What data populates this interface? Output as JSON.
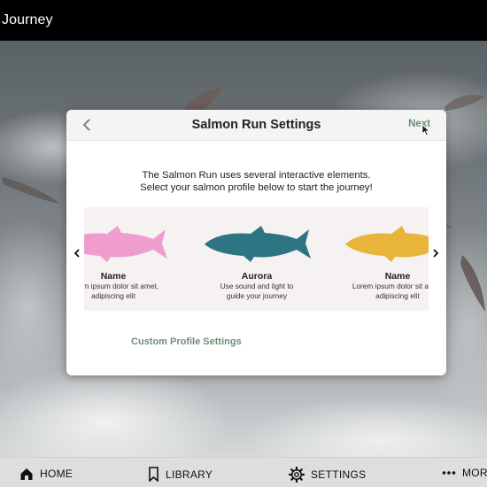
{
  "topbar": {
    "title": "Journey"
  },
  "modal": {
    "title": "Salmon Run Settings",
    "next_label": "Next",
    "intro_line1": "The Salmon Run uses several interactive elements.",
    "intro_line2": "Select your salmon profile below to start the journey!",
    "profiles": [
      {
        "name": "Name",
        "description": "Lorem ipsum dolor sit amet,\nadipiscing elit",
        "color": "#ef9ccf"
      },
      {
        "name": "Aurora",
        "description": "Use sound and light to\nguide your journey",
        "color": "#2e7584"
      },
      {
        "name": "Name",
        "description": "Lorem ipsum dolor sit amet,\nadipiscing elit",
        "color": "#e8b43c"
      }
    ],
    "custom_link": "Custom Profile Settings",
    "accent_color": "#6e8f74"
  },
  "bottomnav": {
    "items": [
      {
        "label": "HOME",
        "icon": "home-icon"
      },
      {
        "label": "LIBRARY",
        "icon": "bookmark-icon"
      },
      {
        "label": "SETTINGS",
        "icon": "gear-icon"
      },
      {
        "label": "MORE",
        "icon": "more-icon"
      }
    ]
  }
}
